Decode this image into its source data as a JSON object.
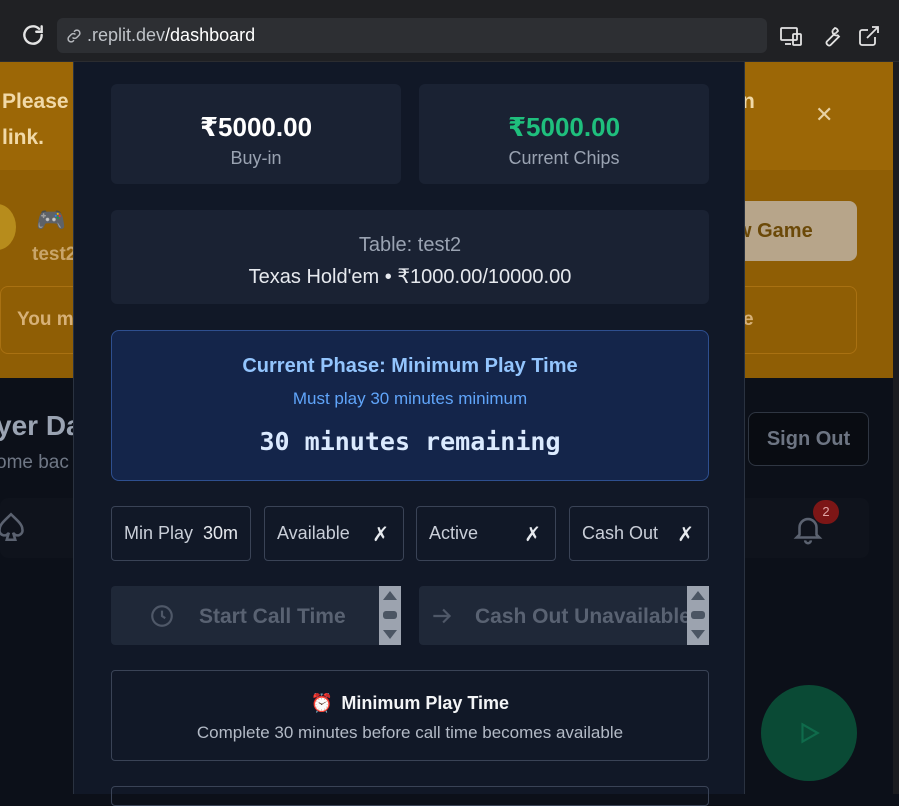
{
  "browser": {
    "url_host": ".replit.dev",
    "url_path": "/dashboard"
  },
  "background": {
    "banner_line1": "Please",
    "banner_line2": "link.",
    "banner_tail": "n",
    "test_label": "test2",
    "new_game_label": "w Game",
    "warning_text": "You m",
    "warning_tail": "e",
    "dashboard_title": "yer Da",
    "dashboard_sub": "ome bac",
    "sign_out_label": "Sign Out",
    "notification_count": "2"
  },
  "modal": {
    "buy_in_value": "₹5000.00",
    "buy_in_label": "Buy-in",
    "current_chips_value": "₹5000.00",
    "current_chips_label": "Current Chips",
    "table_name": "Table: test2",
    "table_game": "Texas Hold'em • ₹1000.00/10000.00",
    "phase_title": "Current Phase: Minimum Play Time",
    "phase_subtitle": "Must play 30 minutes minimum",
    "phase_remaining": "30 minutes remaining",
    "statuses": [
      {
        "label": "Min Play",
        "value": "30m"
      },
      {
        "label": "Available",
        "value": "✗"
      },
      {
        "label": "Active",
        "value": "✗"
      },
      {
        "label": "Cash Out",
        "value": "✗"
      }
    ],
    "start_call_time_label": "Start Call Time",
    "cash_out_label": "Cash Out Unavailable",
    "info_title": "Minimum Play Time",
    "info_description": "Complete 30 minutes before call time becomes available"
  },
  "colors": {
    "accent_green": "#1fbf7d",
    "phase_blue": "#93c5fd",
    "warning_orange": "#9c6706"
  },
  "icons": [
    "reload-icon",
    "link-icon",
    "device-icon",
    "wrench-icon",
    "open-external-icon",
    "close-icon",
    "gamepad-icon",
    "spade-icon",
    "bell-icon",
    "play-icon",
    "clock-icon",
    "arrow-right-icon",
    "alarm-clock-icon"
  ]
}
